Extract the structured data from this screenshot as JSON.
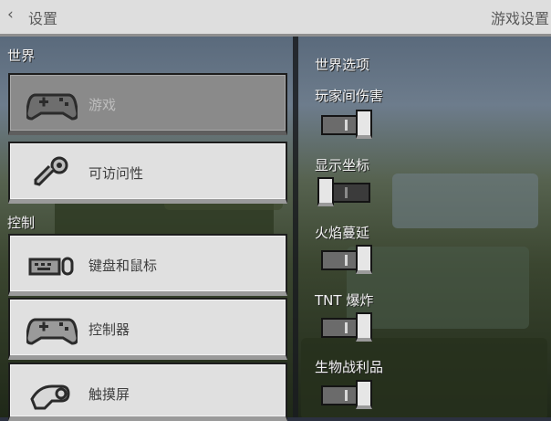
{
  "header": {
    "back_icon": "chevron-left-icon",
    "back_label": "设置",
    "title": "游戏设置"
  },
  "sidebar": {
    "sections": [
      {
        "label": "世界"
      },
      {
        "label": "控制"
      }
    ],
    "items": [
      {
        "label": "游戏",
        "icon": "gamepad-icon",
        "active": true
      },
      {
        "label": "可访问性",
        "icon": "key-icon",
        "active": false
      },
      {
        "label": "键盘和鼠标",
        "icon": "keyboard-mouse-icon",
        "active": false
      },
      {
        "label": "控制器",
        "icon": "controller-icon",
        "active": false
      },
      {
        "label": "触摸屏",
        "icon": "touch-hand-icon",
        "active": false
      }
    ]
  },
  "main": {
    "section_title": "世界选项",
    "options": [
      {
        "label": "玩家间伤害",
        "on": true
      },
      {
        "label": "显示坐标",
        "on": false
      },
      {
        "label": "火焰蔓延",
        "on": true
      },
      {
        "label": "TNT 爆炸",
        "on": true
      },
      {
        "label": "生物战利品",
        "on": true
      }
    ]
  }
}
